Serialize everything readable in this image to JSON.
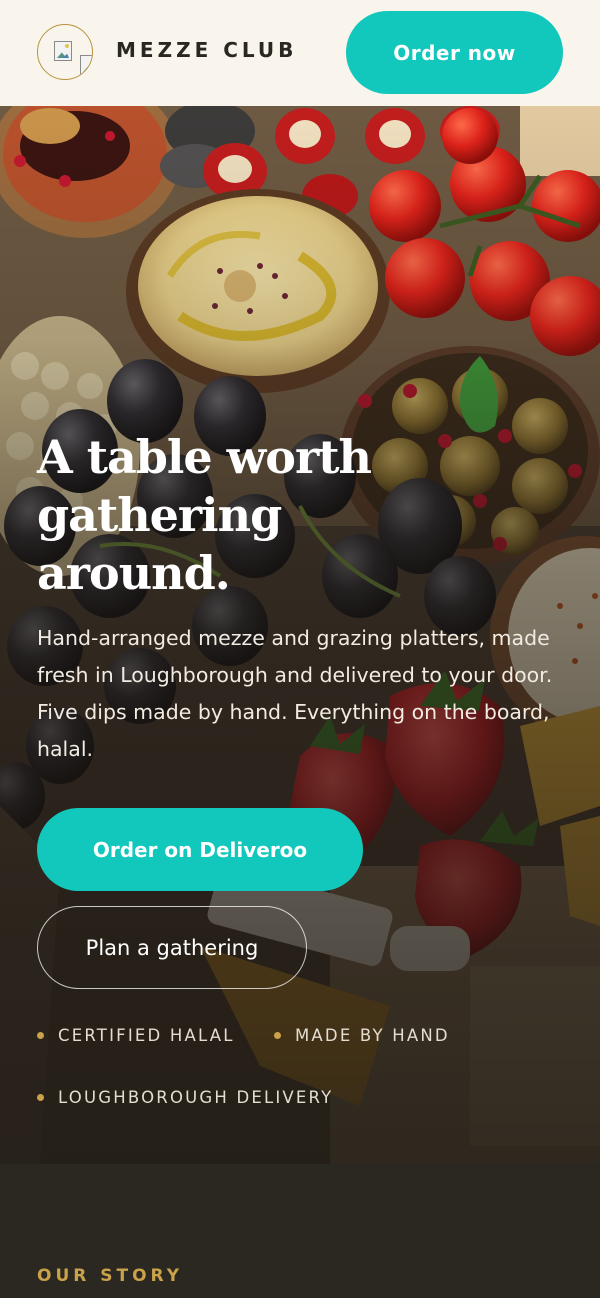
{
  "header": {
    "brand": "MEZZE CLUB",
    "order_button": "Order now"
  },
  "hero": {
    "title": "A table worth gathering around.",
    "description": "Hand-arranged mezze and grazing platters, made fresh in Loughborough and delivered to your door. Five dips made by hand. Everything on the board, halal.",
    "primary_button": "Order on Deliveroo",
    "secondary_button": "Plan a gathering",
    "tags": [
      "CERTIFIED HALAL",
      "MADE BY HAND",
      "LOUGHBOROUGH DELIVERY"
    ]
  },
  "story": {
    "label": "OUR STORY"
  },
  "colors": {
    "accent_teal": "#12c7bb",
    "gold": "#c9a24a",
    "header_bg": "#faf5ec",
    "dark_bg": "#2b2822"
  }
}
